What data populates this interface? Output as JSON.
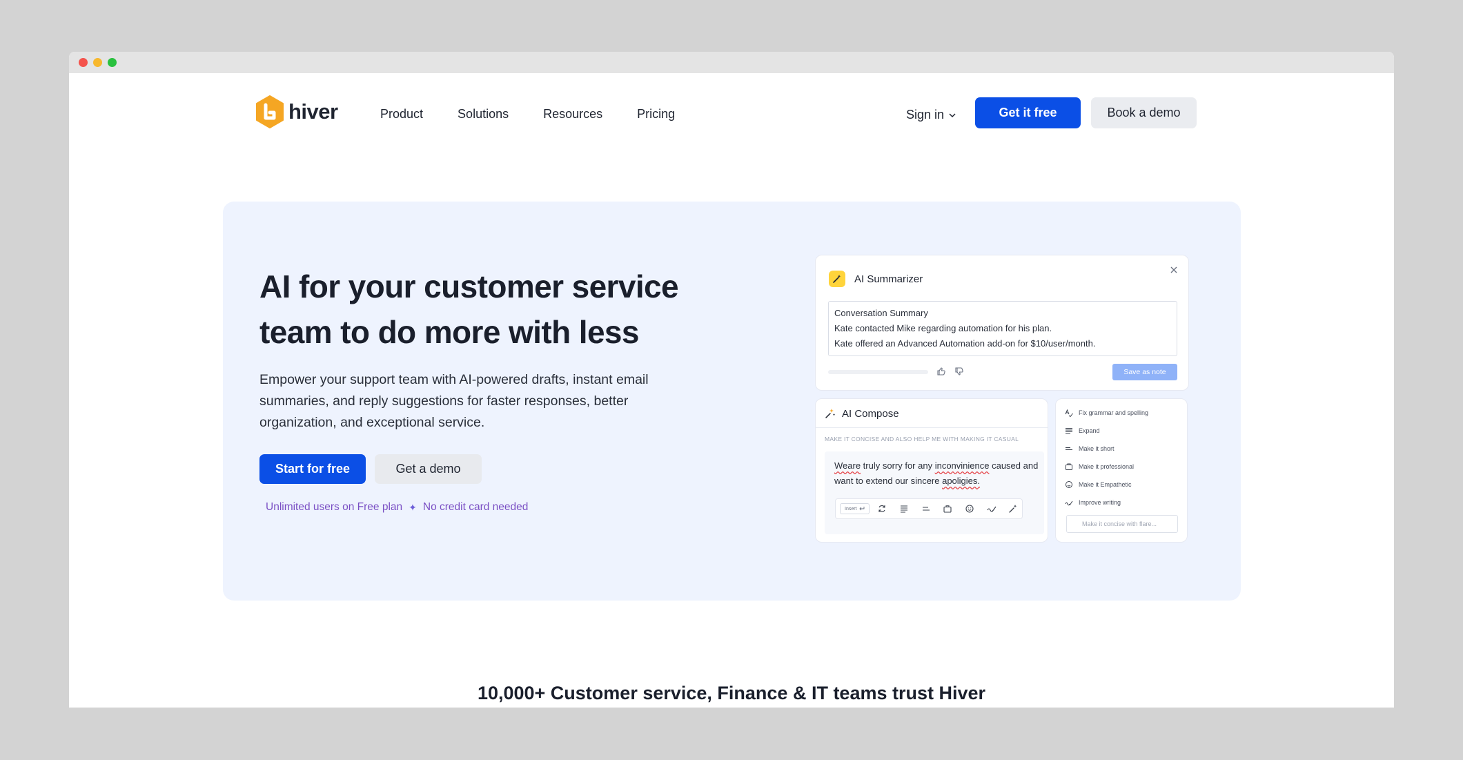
{
  "window": {
    "controls": [
      "close",
      "minimize",
      "maximize"
    ]
  },
  "nav": {
    "logo_text": "hiver",
    "logo_color": "#f5a623",
    "links": [
      "Product",
      "Solutions",
      "Resources",
      "Pricing"
    ],
    "sign_in": "Sign in",
    "get_free": "Get it free",
    "book_demo": "Book a demo"
  },
  "hero": {
    "title": "AI for your customer service team to do more with less",
    "description": "Empower your support team with AI-powered drafts, instant email summaries, and reply suggestions for faster responses, better organization, and exceptional service.",
    "start_btn": "Start for free",
    "demo_btn": "Get a demo",
    "note_left": "Unlimited users on Free plan",
    "note_right": "No credit card needed"
  },
  "summarizer": {
    "title": "AI Summarizer",
    "heading": "Conversation Summary",
    "line1": "Kate contacted Mike regarding automation for his plan.",
    "line2": "Kate offered an Advanced Automation add-on for $10/user/month.",
    "save_btn": "Save as note"
  },
  "compose": {
    "title": "AI Compose",
    "prompt": "MAKE IT CONCISE AND ALSO HELP ME WITH MAKING IT CASUAL",
    "text": {
      "w1": "Weare",
      "t1": " truly sorry for any ",
      "w2": "inconvinience",
      "t2": " caused and want to extend our sincere ",
      "w3": "apoligies."
    },
    "insert_label": "Insert"
  },
  "options": {
    "items": [
      "Fix grammar and spelling",
      "Expand",
      "Make it short",
      "Make it professional",
      "Make it Empathetic",
      "Improve writing"
    ],
    "input_placeholder": "Make it concise with flare..."
  },
  "bottom_text": "10,000+ Customer service, Finance & IT teams trust Hiver"
}
